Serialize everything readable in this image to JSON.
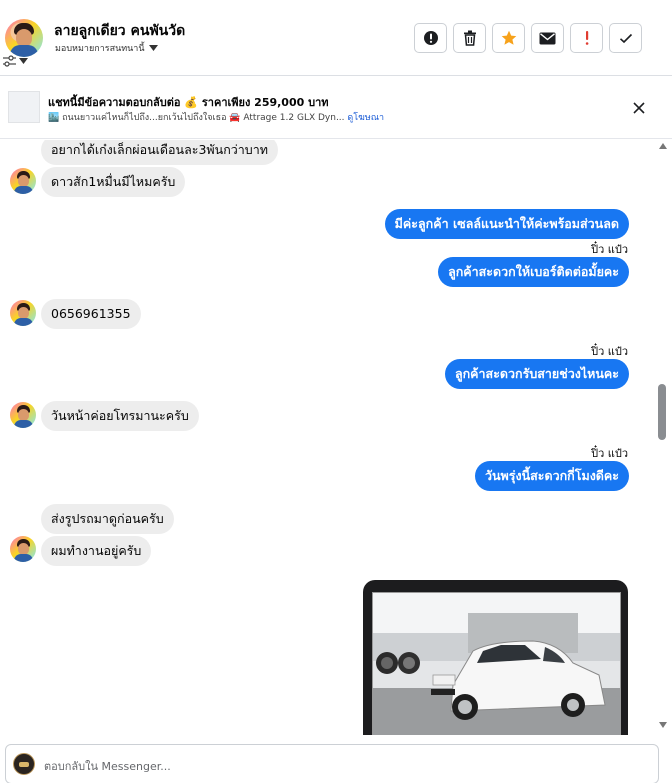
{
  "header": {
    "name": "ลายลูกเดียว คนพันวัด",
    "assign_label": "มอบหมายการสนทนานี้",
    "actions": [
      {
        "name": "mark-spam-button",
        "icon": "alert-circle-icon"
      },
      {
        "name": "delete-button",
        "icon": "trash-icon"
      },
      {
        "name": "star-button",
        "icon": "star-icon"
      },
      {
        "name": "mark-unread-button",
        "icon": "envelope-icon"
      },
      {
        "name": "follow-up-button",
        "icon": "exclamation-icon"
      },
      {
        "name": "done-button",
        "icon": "check-icon"
      }
    ]
  },
  "ad": {
    "title": "แชทนี้มีข้อความตอบกลับต่อ 💰 ราคาเพียง 259,000 บาท",
    "subtitle": "🏙️ ถนนยาวแค่ไหนก็ไปถึง...ยกเว้นไปถึงใจเธอ 🚘 Attrage 1.2 GLX Dyn...",
    "link": "ดูโฆษณา"
  },
  "messages": [
    {
      "dir": "in",
      "text": "อยากได้เก๋งเล็กผ่อนเดือนละ3พันกว่าบาท"
    },
    {
      "dir": "in",
      "text": "ดาวสัก1หมื่นมีไหมครับ"
    },
    {
      "dir": "out",
      "text": "มีค่ะลูกค้า  เซลล์แนะนำให้ค่ะพร้อมส่วนลด"
    },
    {
      "dir": "out",
      "text": "ลูกค้าสะดวกให้เบอร์ติดต่อมั้ยคะ"
    },
    {
      "dir": "in",
      "text": "0656961355"
    },
    {
      "dir": "out",
      "text": "ลูกค้าสะดวกรับสายช่วงไหนคะ"
    },
    {
      "dir": "in",
      "text": "วันหน้าค่อยโทรมานะครับ"
    },
    {
      "dir": "out",
      "text": "วันพรุ่งนี้สะดวกกี่โมงดีคะ"
    },
    {
      "dir": "in",
      "text": "ส่งรูปรถมาดูก่อนครับ"
    },
    {
      "dir": "in",
      "text": "ผมทำงานอยู่ครับ"
    }
  ],
  "seen_label": "ปิ๋ว แป๋ว",
  "composer": {
    "placeholder": "ตอบกลับใน Messenger..."
  },
  "colors": {
    "accent": "#1877f2",
    "incoming_bubble": "#ededed",
    "star": "#f7a21b",
    "follow_up": "#e03c31"
  }
}
